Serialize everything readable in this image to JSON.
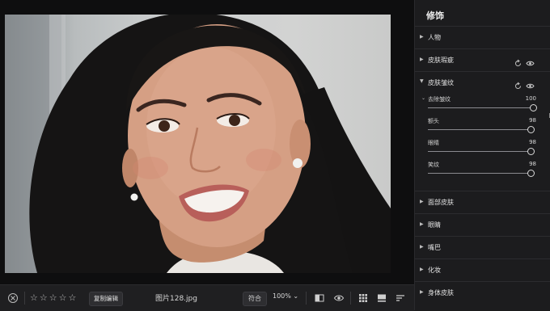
{
  "panel": {
    "title": "修饰",
    "sections": {
      "person": "人物",
      "blemish": "皮肤瑕疵",
      "wrinkle": "皮肤皱纹",
      "face_skin": "面部皮肤",
      "eyes": "眼睛",
      "mouth": "嘴巴",
      "makeup": "化妆",
      "body_skin": "身体皮肤"
    },
    "wrinkle_controls": {
      "remove": {
        "label": "去除皱纹",
        "value": "100",
        "level": 1.0
      },
      "forehead": {
        "label": "额头",
        "value": "98",
        "level": 0.98
      },
      "eye_area": {
        "label": "眼睛",
        "value": "98",
        "level": 0.98
      },
      "smile": {
        "label": "笑纹",
        "value": "98",
        "level": 0.98
      }
    }
  },
  "toolbar": {
    "rating_stars": [
      "☆",
      "☆",
      "☆",
      "☆",
      "☆"
    ],
    "copy_edit_label": "复制编辑",
    "filename": "图片128.jpg",
    "fit_label": "符合",
    "zoom_label": "100% ⌄"
  },
  "icons": {
    "close": "close-circle-icon",
    "compare": "before-after-icon",
    "preview": "eye-icon",
    "grid": "grid-icon",
    "filmstrip": "filmstrip-icon",
    "sort": "sort-lines-icon",
    "reset": "reset-icon",
    "visibility": "eye-icon"
  },
  "colors": {
    "panel_bg": "#1c1c1e",
    "toolbar_bg": "#1f1f21",
    "canvas_bg": "#0e0e0f"
  }
}
